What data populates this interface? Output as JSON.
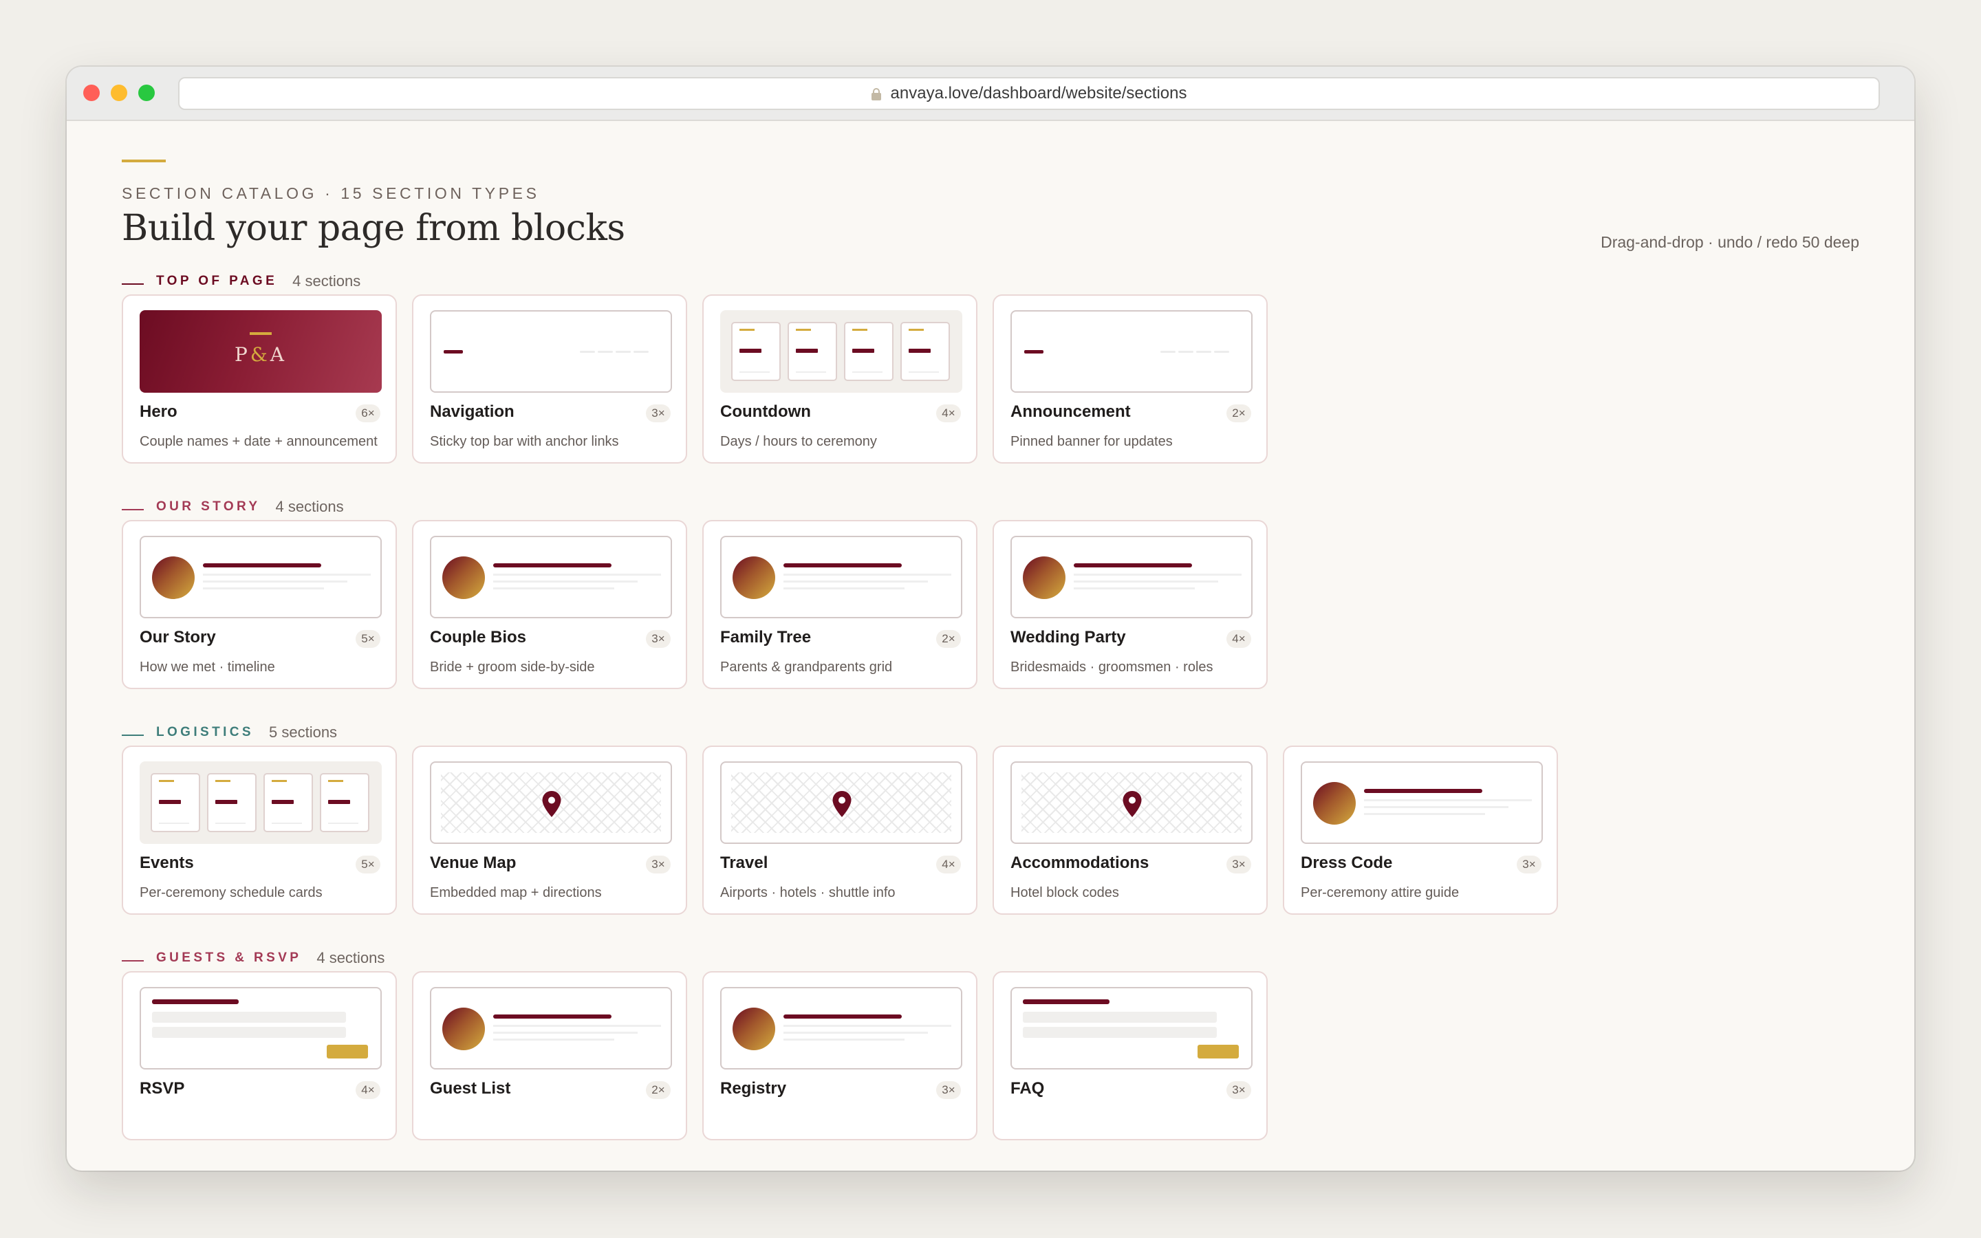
{
  "browser": {
    "url": "anvaya.love/dashboard/website/sections"
  },
  "header": {
    "eyebrow": "SECTION CATALOG · 15 SECTION TYPES",
    "title": "Build your page from blocks",
    "meta": "Drag-and-drop · undo / redo 50 deep"
  },
  "colors": {
    "accent_gold": "#d4ab3e",
    "brand_burgundy": "#6c0c22",
    "logistics_teal": "#3e7d7a"
  },
  "groups": [
    {
      "title": "TOP OF PAGE",
      "count": "4 sections",
      "color": "#6c0c22",
      "cards": [
        {
          "title": "Hero",
          "badge": "6×",
          "desc": "Couple names + date + announcement",
          "thumb": "hero",
          "monogram": [
            "P",
            "&",
            "A"
          ]
        },
        {
          "title": "Navigation",
          "badge": "3×",
          "desc": "Sticky top bar with anchor links",
          "thumb": "nav"
        },
        {
          "title": "Countdown",
          "badge": "4×",
          "desc": "Days / hours to ceremony",
          "thumb": "tiles"
        },
        {
          "title": "Announcement",
          "badge": "2×",
          "desc": "Pinned banner for updates",
          "thumb": "nav"
        }
      ]
    },
    {
      "title": "OUR STORY",
      "count": "4 sections",
      "color": "#a33a55",
      "cards": [
        {
          "title": "Our Story",
          "badge": "5×",
          "desc": "How we met · timeline",
          "thumb": "profile"
        },
        {
          "title": "Couple Bios",
          "badge": "3×",
          "desc": "Bride + groom side-by-side",
          "thumb": "profile"
        },
        {
          "title": "Family Tree",
          "badge": "2×",
          "desc": "Parents & grandparents grid",
          "thumb": "profile"
        },
        {
          "title": "Wedding Party",
          "badge": "4×",
          "desc": "Bridesmaids · groomsmen · roles",
          "thumb": "profile"
        }
      ]
    },
    {
      "title": "LOGISTICS",
      "count": "5 sections",
      "color": "#3e7d7a",
      "cards": [
        {
          "title": "Events",
          "badge": "5×",
          "desc": "Per-ceremony schedule cards",
          "thumb": "tiles"
        },
        {
          "title": "Venue Map",
          "badge": "3×",
          "desc": "Embedded map + directions",
          "thumb": "map"
        },
        {
          "title": "Travel",
          "badge": "4×",
          "desc": "Airports · hotels · shuttle info",
          "thumb": "map"
        },
        {
          "title": "Accommodations",
          "badge": "3×",
          "desc": "Hotel block codes",
          "thumb": "map"
        },
        {
          "title": "Dress Code",
          "badge": "3×",
          "desc": "Per-ceremony attire guide",
          "thumb": "profile"
        }
      ]
    },
    {
      "title": "GUESTS & RSVP",
      "count": "4 sections",
      "color": "#a33a55",
      "cards": [
        {
          "title": "RSVP",
          "badge": "4×",
          "desc": "",
          "thumb": "form"
        },
        {
          "title": "Guest List",
          "badge": "2×",
          "desc": "",
          "thumb": "profile"
        },
        {
          "title": "Registry",
          "badge": "3×",
          "desc": "",
          "thumb": "profile"
        },
        {
          "title": "FAQ",
          "badge": "3×",
          "desc": "",
          "thumb": "form"
        }
      ]
    }
  ]
}
